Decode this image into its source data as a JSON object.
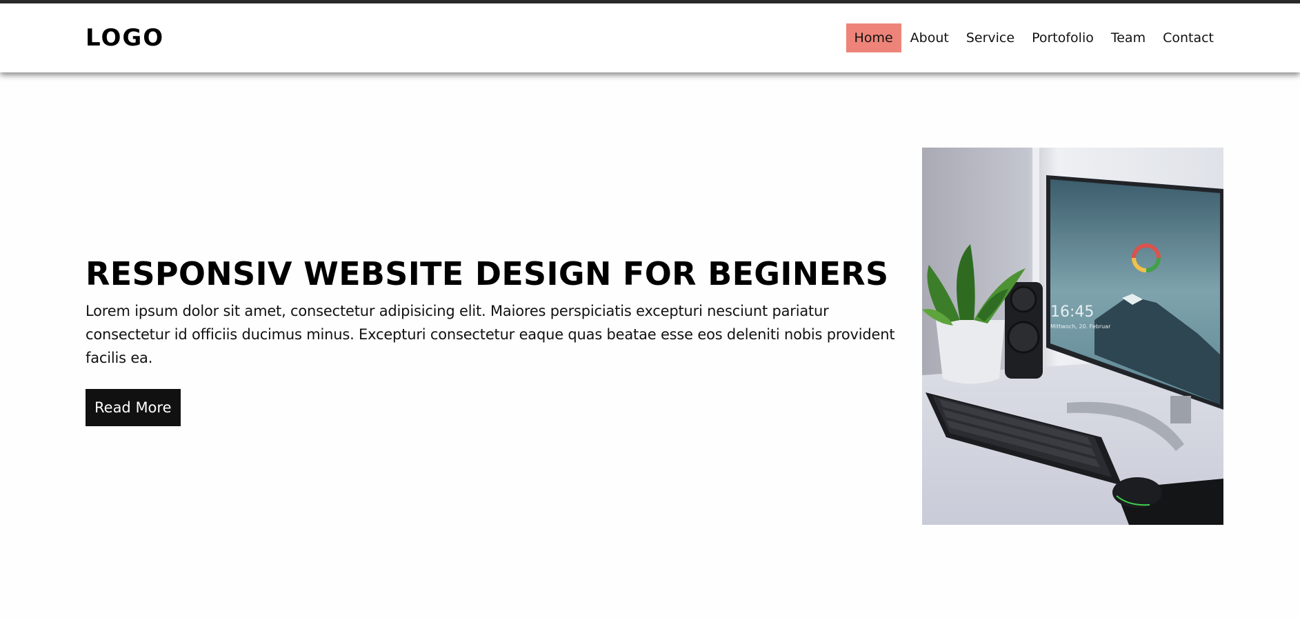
{
  "header": {
    "logo": "LOGO",
    "nav": [
      {
        "label": "Home",
        "active": true
      },
      {
        "label": "About"
      },
      {
        "label": "Service"
      },
      {
        "label": "Portofolio"
      },
      {
        "label": "Team"
      },
      {
        "label": "Contact"
      }
    ]
  },
  "hero": {
    "title": "RESPONSIV WEBSITE DESIGN FOR BEGINERS",
    "description": "Lorem ipsum dolor sit amet, consectetur adipisicing elit. Maiores perspiciatis excepturi nesciunt pariatur consectetur id officiis ducimus minus. Excepturi consectetur eaque quas beatae esse eos deleniti nobis provident facilis ea.",
    "button_label": "Read More",
    "image": {
      "screen_time": "16:45",
      "screen_date": "Mittwoch, 20. Februar"
    }
  },
  "colors": {
    "active_nav_bg": "#ee8479",
    "button_bg": "#111111",
    "text": "#111111"
  }
}
